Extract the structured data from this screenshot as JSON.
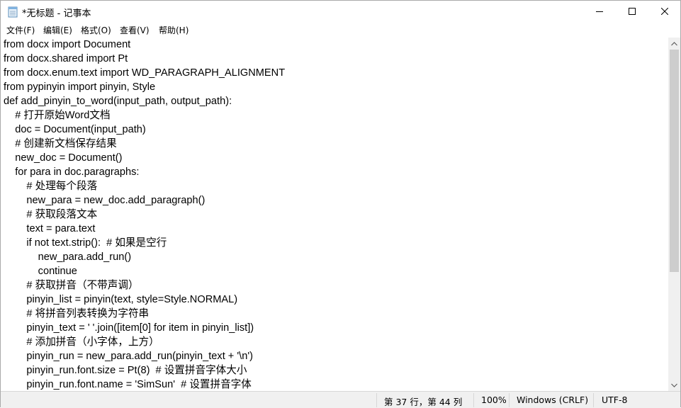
{
  "window": {
    "title": "*无标题 - 记事本",
    "controls": [
      "minimize-icon",
      "maximize-icon",
      "close-icon"
    ]
  },
  "menu": {
    "items": [
      "文件(F)",
      "编辑(E)",
      "格式(O)",
      "查看(V)",
      "帮助(H)"
    ]
  },
  "editor": {
    "lines": [
      "from docx import Document",
      "from docx.shared import Pt",
      "from docx.enum.text import WD_PARAGRAPH_ALIGNMENT",
      "from pypinyin import pinyin, Style",
      "def add_pinyin_to_word(input_path, output_path):",
      "    # 打开原始Word文档",
      "    doc = Document(input_path)",
      "    # 创建新文档保存结果",
      "    new_doc = Document()",
      "    for para in doc.paragraphs:",
      "        # 处理每个段落",
      "        new_para = new_doc.add_paragraph()",
      "        # 获取段落文本",
      "        text = para.text",
      "        if not text.strip():  # 如果是空行",
      "            new_para.add_run()",
      "            continue",
      "        # 获取拼音（不带声调）",
      "        pinyin_list = pinyin(text, style=Style.NORMAL)",
      "        # 将拼音列表转换为字符串",
      "        pinyin_text = ' '.join([item[0] for item in pinyin_list])",
      "        # 添加拼音（小字体，上方）",
      "        pinyin_run = new_para.add_run(pinyin_text + '\\n')",
      "        pinyin_run.font.size = Pt(8)  # 设置拼音字体大小",
      "        pinyin_run.font.name = 'SimSun'  # 设置拼音字体"
    ]
  },
  "status": {
    "position": "第 37 行，第 44 列",
    "zoom": "100%",
    "line_ending": "Windows (CRLF)",
    "encoding": "UTF-8"
  }
}
